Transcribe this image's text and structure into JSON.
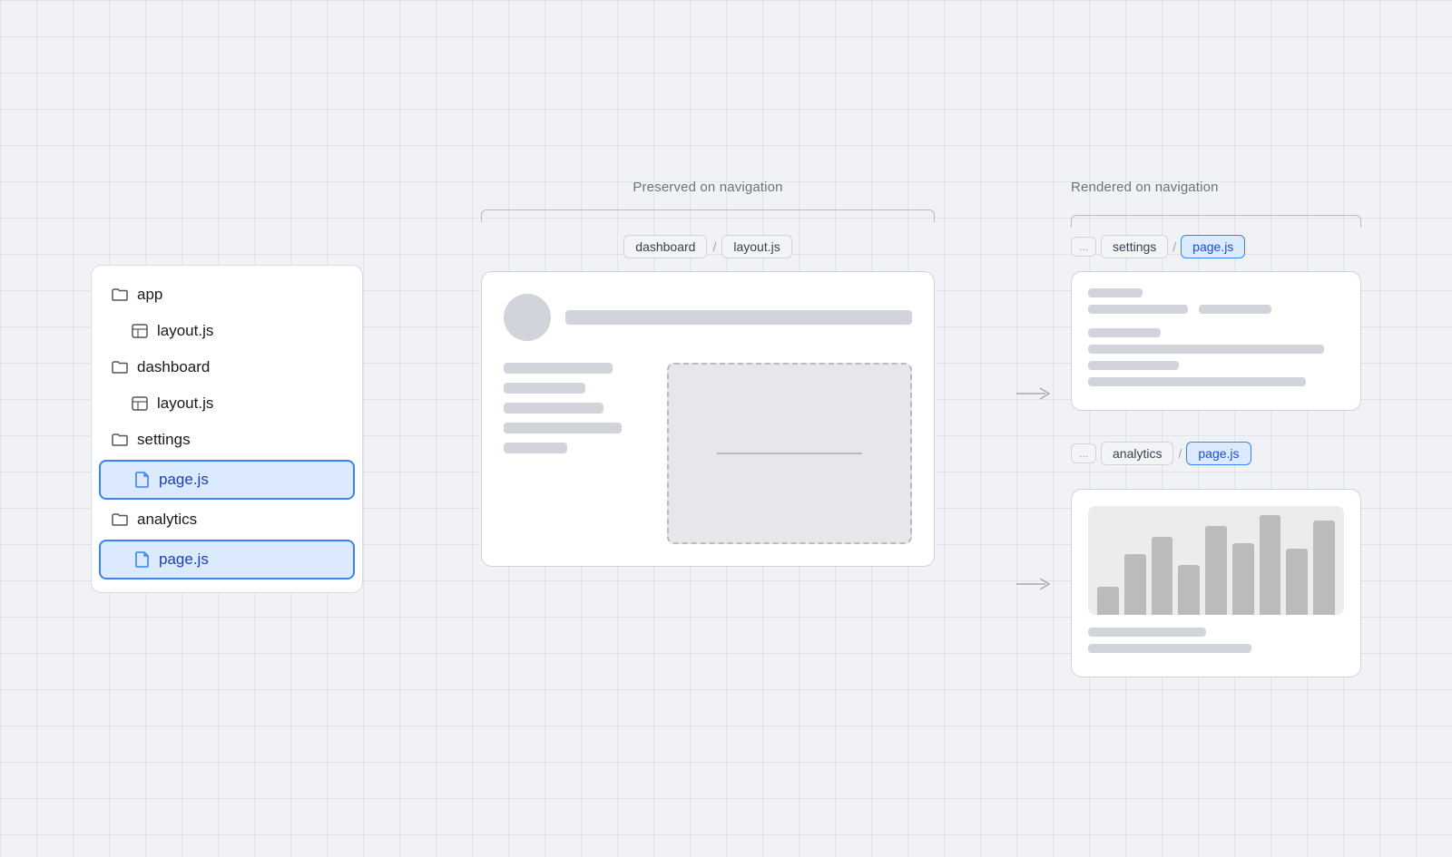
{
  "fileTree": {
    "items": [
      {
        "id": "app",
        "label": "app",
        "type": "folder",
        "indent": false,
        "active": false
      },
      {
        "id": "layout-js-1",
        "label": "layout.js",
        "type": "layout",
        "indent": true,
        "active": false
      },
      {
        "id": "dashboard",
        "label": "dashboard",
        "type": "folder",
        "indent": false,
        "active": false
      },
      {
        "id": "layout-js-2",
        "label": "layout.js",
        "type": "layout",
        "indent": true,
        "active": false
      },
      {
        "id": "settings",
        "label": "settings",
        "type": "folder",
        "indent": false,
        "active": false
      },
      {
        "id": "page-js-1",
        "label": "page.js",
        "type": "file",
        "indent": true,
        "active": true
      },
      {
        "id": "analytics",
        "label": "analytics",
        "type": "folder",
        "indent": false,
        "active": false
      },
      {
        "id": "page-js-2",
        "label": "page.js",
        "type": "file",
        "indent": true,
        "active": true
      }
    ]
  },
  "diagram": {
    "preservedLabel": "Preserved on navigation",
    "renderedLabel": "Rendered on navigation",
    "breadcrumbs": {
      "middle": [
        {
          "label": "dashboard",
          "active": false
        },
        {
          "label": "/",
          "sep": true
        },
        {
          "label": "layout.js",
          "active": false
        }
      ],
      "right1": [
        {
          "label": "...",
          "ellipsis": true
        },
        {
          "label": "settings",
          "active": false
        },
        {
          "label": "/",
          "sep": true
        },
        {
          "label": "page.js",
          "active": true
        }
      ],
      "right2": [
        {
          "label": "...",
          "ellipsis": true
        },
        {
          "label": "analytics",
          "active": false
        },
        {
          "label": "/",
          "sep": true
        },
        {
          "label": "page.js",
          "active": true
        }
      ]
    }
  },
  "barChart": {
    "bars": [
      25,
      55,
      70,
      45,
      80,
      65,
      90,
      60,
      85
    ],
    "colors": "#bbb"
  }
}
